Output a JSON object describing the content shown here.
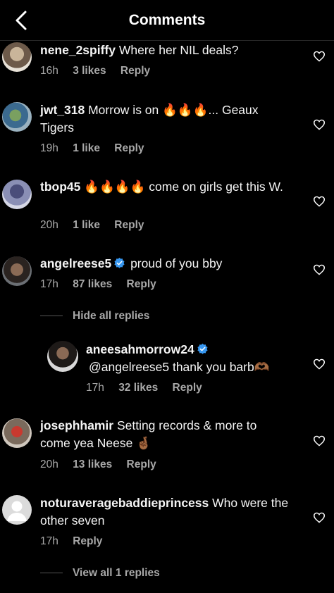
{
  "header": {
    "title": "Comments"
  },
  "comments": [
    {
      "username": "nene_2spiffy",
      "text": "Where her NIL deals?",
      "time": "16h",
      "likes": "3 likes",
      "reply": "Reply"
    },
    {
      "username": "jwt_318",
      "text": "Morrow is on 🔥🔥🔥... Geaux Tigers",
      "time": "19h",
      "likes": "1 like",
      "reply": "Reply"
    },
    {
      "username": "tbop45",
      "text": "🔥🔥🔥🔥 come on girls get this W.",
      "time": "20h",
      "likes": "1 like",
      "reply": "Reply"
    },
    {
      "username": "angelreese5",
      "verified": true,
      "text": "proud of you bby",
      "time": "17h",
      "likes": "87 likes",
      "reply": "Reply",
      "replies_toggle": "Hide all replies",
      "replies": [
        {
          "username": "aneesahmorrow24",
          "verified": true,
          "text": "@angelreese5 thank you barb🫶🏾",
          "time": "17h",
          "likes": "32 likes",
          "reply": "Reply"
        }
      ]
    },
    {
      "username": "josephhamir",
      "text": "Setting records & more to come yea Neese 🤞🏾",
      "time": "20h",
      "likes": "13 likes",
      "reply": "Reply"
    },
    {
      "username": "noturaveragebaddieprincess",
      "text": "Who were the other seven",
      "time": "17h",
      "reply": "Reply",
      "replies_toggle": "View all 1 replies"
    }
  ],
  "icons": {
    "back": "chevron-left-icon",
    "like": "heart-outline-icon",
    "verified": "verified-badge-icon"
  },
  "colors": {
    "background": "#000000",
    "text": "#ffffff",
    "meta": "#a8a8a8",
    "verified": "#3797f0"
  }
}
